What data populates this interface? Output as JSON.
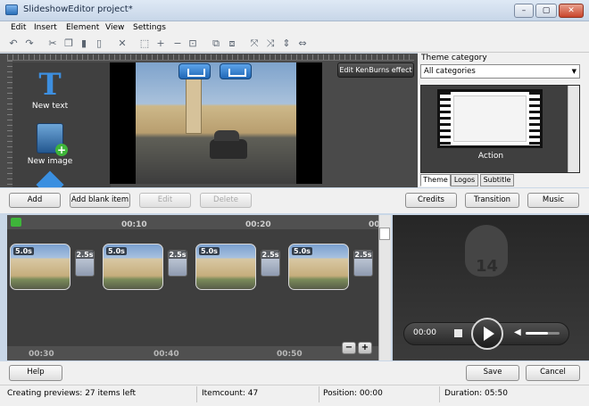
{
  "window": {
    "title": "SlideshowEditor project*"
  },
  "menu": [
    "Edit",
    "Insert",
    "Element",
    "View",
    "Settings"
  ],
  "toolbar": [
    "undo-icon",
    "redo-icon",
    "cut-icon",
    "copy-icon",
    "paste-icon",
    "page-icon",
    "delete-icon",
    "select-icon",
    "zoom-in-icon",
    "zoom-out-icon",
    "fit-icon",
    "group-icon",
    "ungroup-icon",
    "flip-icon",
    "rotate-icon",
    "align-v-icon",
    "align-h-icon"
  ],
  "library": {
    "new_text": "New text",
    "new_image": "New image"
  },
  "kenburns_label": "Edit KenBurns effect",
  "theme": {
    "label": "Theme category",
    "selected": "All categories",
    "item": "Action",
    "tabs": [
      "Theme",
      "Logos",
      "Subtitle"
    ]
  },
  "actions": {
    "add": "Add",
    "add_blank": "Add blank item",
    "edit": "Edit",
    "delete": "Delete",
    "credits": "Credits",
    "transition": "Transition",
    "music": "Music"
  },
  "timeline": {
    "ticks_top": [
      "00:10",
      "00:20",
      "00"
    ],
    "ticks_bottom": [
      "00:30",
      "00:40",
      "00:50"
    ],
    "clips": [
      {
        "duration": "5.0s"
      },
      {
        "duration": "5.0s"
      },
      {
        "duration": "5.0s"
      },
      {
        "duration": "5.0s"
      }
    ],
    "transitions": [
      {
        "duration": "2.5s"
      },
      {
        "duration": "2.5s"
      },
      {
        "duration": "2.5s"
      },
      {
        "duration": "2.5s"
      }
    ]
  },
  "player": {
    "time": "00:00",
    "logo_number": "14",
    "volume": 0.65
  },
  "footer": {
    "help": "Help",
    "save": "Save",
    "cancel": "Cancel"
  },
  "status": {
    "previews": "Creating previews: 27 items left",
    "itemcount": "Itemcount: 47",
    "position": "Position: 00:00",
    "duration": "Duration: 05:50"
  }
}
